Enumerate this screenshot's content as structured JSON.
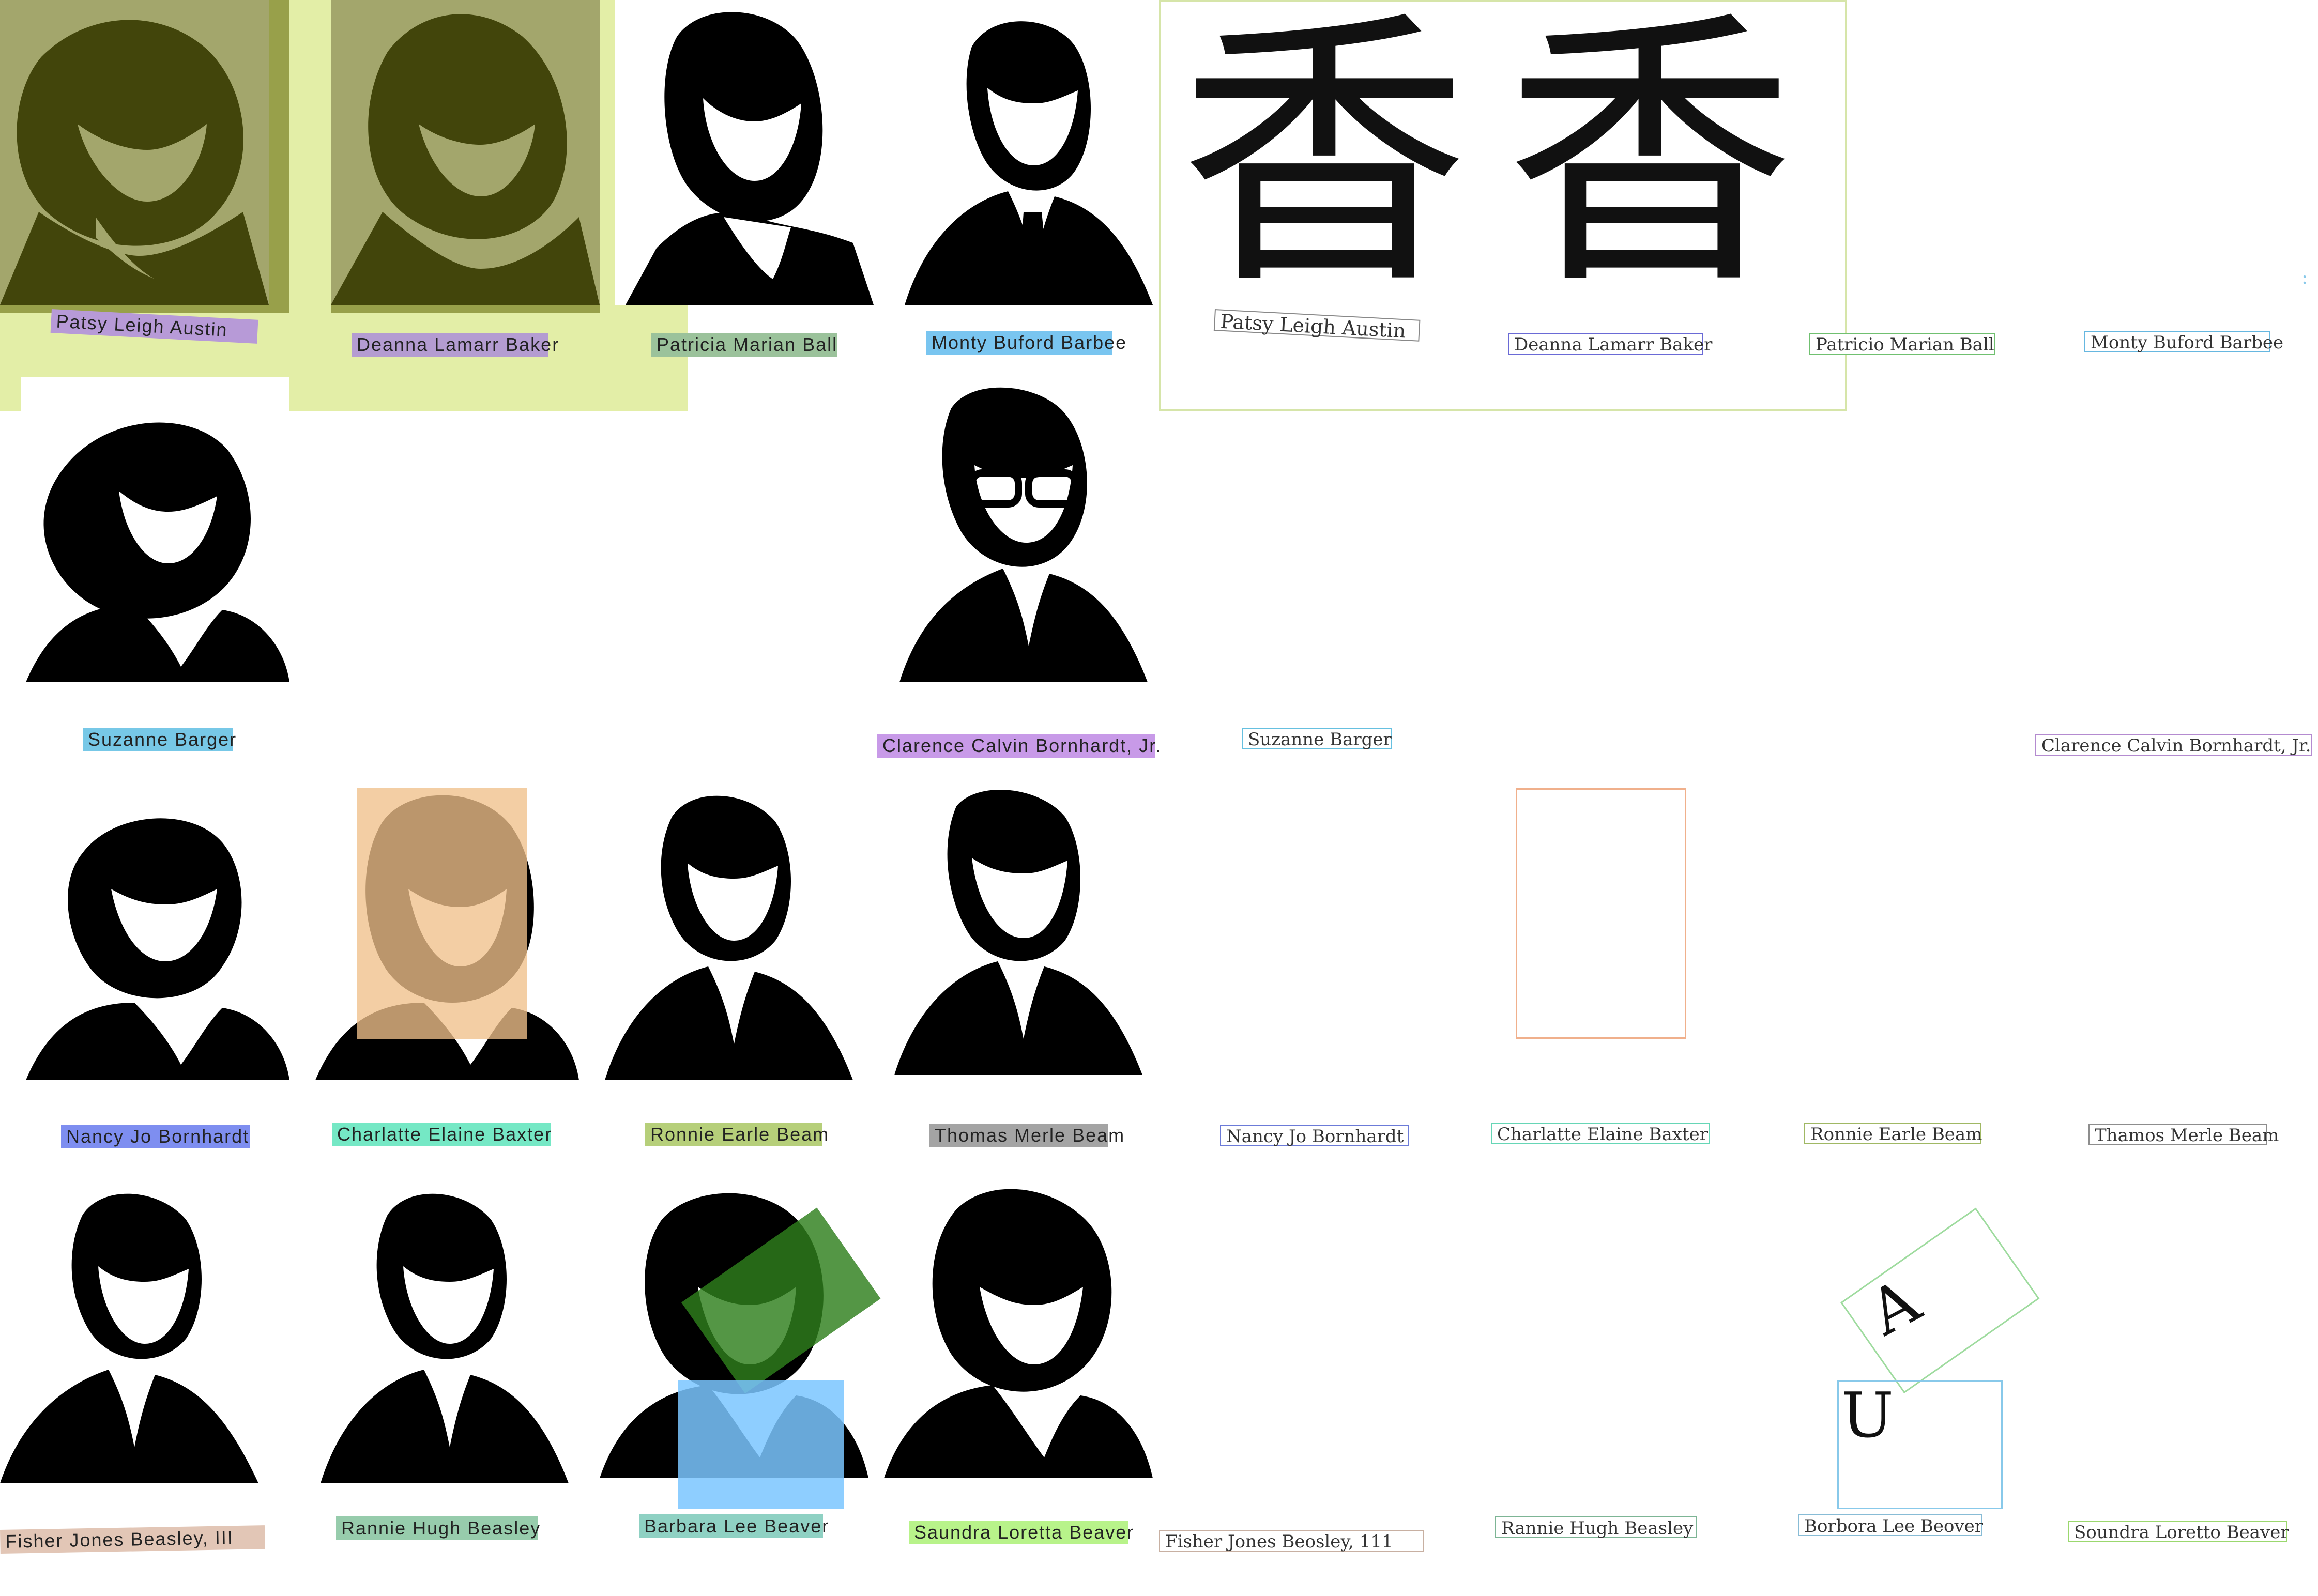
{
  "panels": {
    "left_title": "",
    "right_title": ""
  },
  "people": [
    {
      "name": "Patsy Leigh Austin",
      "left_tint": "#b79ad7",
      "right_border": "#888888"
    },
    {
      "name": "Deanna Lamarr Baker",
      "left_tint": "#b49cd1",
      "right_border": "#6a6ad6"
    },
    {
      "name": "Patricia Marian Ball",
      "left_tint": "#9bc29b",
      "right_border": "#70c070",
      "right_text": "Patricio Marian Ball"
    },
    {
      "name": "Monty Buford Barbee",
      "left_tint": "#79c5f0",
      "right_border": "#66b7e0"
    },
    {
      "name": "Suzanne Barger",
      "left_tint": "#77c8e7",
      "right_border": "#66c0e0"
    },
    {
      "name": "Clarence Calvin Bornhardt, Jr.",
      "left_tint": "#c89ae8",
      "right_border": "#b48bd0"
    },
    {
      "name": "Nancy Jo Bornhardt",
      "left_tint": "#7e8ef0",
      "right_border": "#6c7bd8"
    },
    {
      "name": "Charlatte Elaine Baxter",
      "left_tint": "#75e8c5",
      "right_border": "#66d6b6"
    },
    {
      "name": "Ronnie Earle Beam",
      "left_tint": "#b6cf7a",
      "right_border": "#a0b864"
    },
    {
      "name": "Thomas Merle Beam",
      "left_tint": "#a4a4a4",
      "right_border": "#8d8d8d",
      "right_text": "Thamos Merle Beam"
    },
    {
      "name": "Fisher Jones Beasley, III",
      "left_tint": "#e2c6b6",
      "right_border": "#c8b0a2",
      "right_text": "Fisher Jones Beosley, 111"
    },
    {
      "name": "Rannie Hugh Beasley",
      "left_tint": "#97ccac",
      "right_border": "#7db595"
    },
    {
      "name": "Barbara Lee Beaver",
      "left_tint": "#8fd1c3",
      "right_border": "#88bcd6",
      "right_text": "Borbora Lee Beover"
    },
    {
      "name": "Saundra Loretta Beaver",
      "left_tint": "#b8f38a",
      "right_border": "#9bd86e",
      "right_text": "Soundra Loretto Beaver"
    }
  ],
  "overlays": {
    "big_han_1": "香",
    "big_han_2": "香",
    "letter_a": "A",
    "letter_u": "U",
    "small_mark": ":"
  },
  "colors": {
    "yellow_region": "#d9e889",
    "olive_tint": "#6b6f12",
    "orange_tint": "#efc08b",
    "green_tint": "#2e7f1c",
    "blue_tint": "#7ac6ff",
    "han_box_border": "#d6e5a9",
    "orange_box_border": "#f0b08c",
    "green_box_border": "#9edb9e",
    "blue_box_border": "#88c9ea"
  }
}
